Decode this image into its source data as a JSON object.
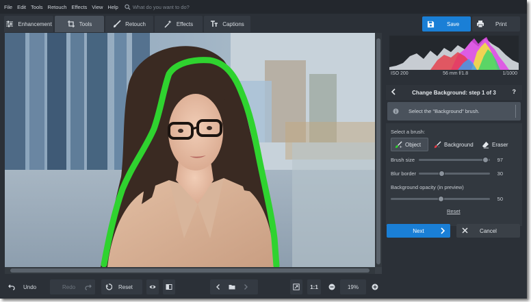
{
  "menu": [
    "File",
    "Edit",
    "Tools",
    "Retouch",
    "Effects",
    "View",
    "Help"
  ],
  "search": {
    "placeholder": "What do you want to do?"
  },
  "tabs": [
    {
      "label": "Enhancement",
      "icon": "sliders-icon"
    },
    {
      "label": "Tools",
      "icon": "crop-icon",
      "active": true
    },
    {
      "label": "Retouch",
      "icon": "brush-icon"
    },
    {
      "label": "Effects",
      "icon": "magic-wand-icon"
    },
    {
      "label": "Captions",
      "icon": "text-icon"
    }
  ],
  "toolbar": {
    "save_label": "Save",
    "print_label": "Print"
  },
  "histogram": {
    "iso": "ISO 200",
    "lens": "56 mm f/1.8",
    "shutter": "1/1000"
  },
  "panel": {
    "title": "Change Background: step 1 of 3",
    "help": "?",
    "hint": "Select the \"Background\" brush.",
    "select_brush_label": "Select a brush:",
    "brushes": [
      {
        "label": "Object",
        "active": true
      },
      {
        "label": "Background",
        "active": false
      },
      {
        "label": "Eraser",
        "active": false
      }
    ],
    "sliders": [
      {
        "label": "Brush size",
        "value": "97",
        "level": 0.97
      },
      {
        "label": "Blur border",
        "value": "30",
        "level": 0.3
      },
      {
        "label": "Background opacity (in preview)",
        "value": "50",
        "level": 0.5
      }
    ],
    "reset_label": "Reset",
    "next_label": "Next",
    "cancel_label": "Cancel"
  },
  "bottom": {
    "undo_label": "Undo",
    "redo_label": "Redo",
    "reset_label": "Reset",
    "ratio_label": "1:1",
    "zoom": "19%"
  },
  "colors": {
    "accent": "#1a7fd6",
    "selection_stroke": "#2fd32f",
    "panel_bg": "#2b3037"
  }
}
